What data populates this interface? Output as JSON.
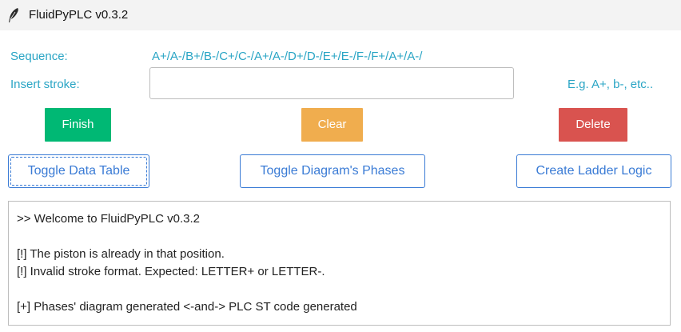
{
  "window": {
    "title": "FluidPyPLC v0.3.2",
    "icon": "feather-quill-icon"
  },
  "form": {
    "sequence_label": "Sequence:",
    "sequence_value": "A+/A-/B+/B-/C+/C-/A+/A-/D+/D-/E+/E-/F-/F+/A+/A-/",
    "insert_label": "Insert stroke:",
    "stroke_input_value": "",
    "hint": "E.g. A+, b-, etc.."
  },
  "actions": {
    "finish": "Finish",
    "clear": "Clear",
    "delete": "Delete",
    "toggle_data_table": "Toggle Data Table",
    "toggle_phases": "Toggle Diagram's Phases",
    "create_ladder": "Create Ladder Logic"
  },
  "colors": {
    "accent_text": "#2aa5c5",
    "finish": "#00b874",
    "clear": "#f0ad4e",
    "delete": "#d9534f",
    "outline_button": "#3a7bd5"
  },
  "console": {
    "line_1": ">> Welcome to FluidPyPLC v0.3.2",
    "line_2": "",
    "line_3": "[!] The piston is already in that position.",
    "line_4": "[!] Invalid stroke format. Expected: LETTER+ or LETTER-.",
    "line_5": "",
    "line_6": "[+] Phases' diagram generated <-and-> PLC ST code generated"
  }
}
